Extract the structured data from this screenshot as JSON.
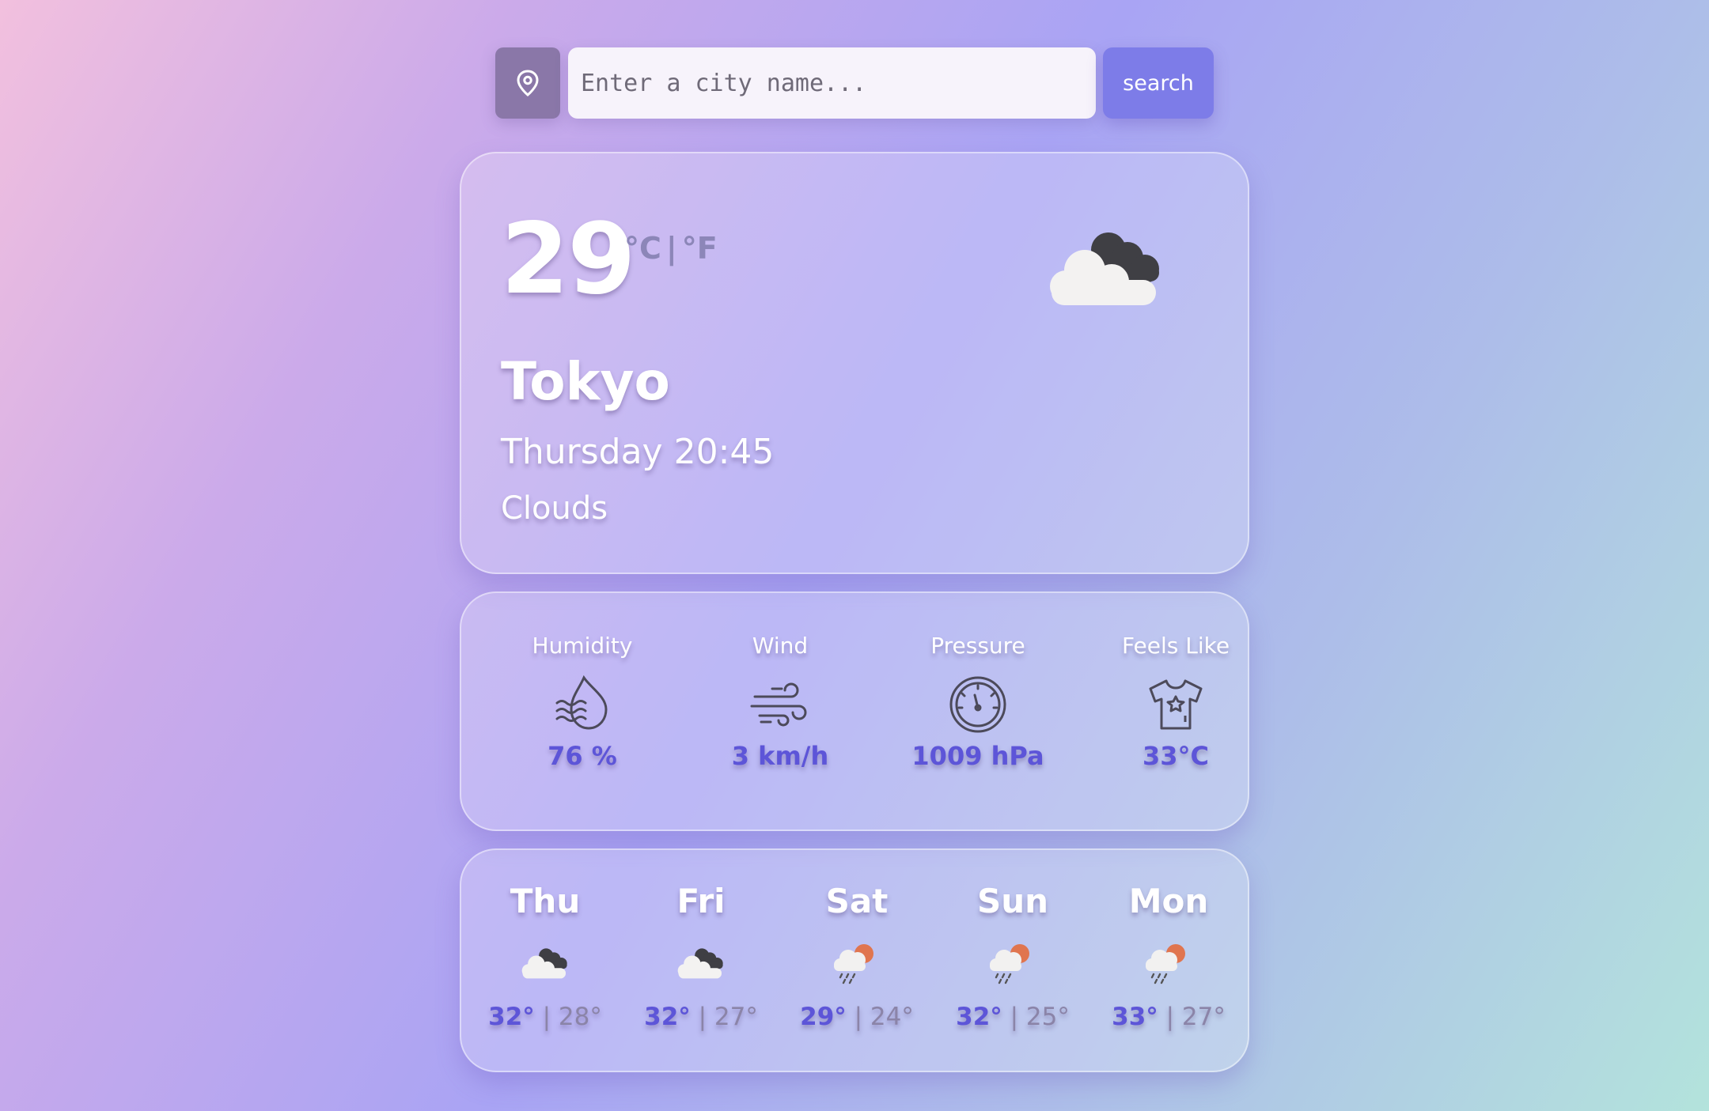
{
  "search": {
    "placeholder": "Enter a city name...",
    "button_label": "search",
    "location_icon": "map-pin-icon"
  },
  "current": {
    "temperature": "29",
    "unit_c": "°C",
    "unit_separator": "|",
    "unit_f": "°F",
    "city": "Tokyo",
    "datetime": "Thursday 20:45",
    "description": "Clouds",
    "icon": "clouds-icon"
  },
  "details": [
    {
      "label": "Humidity",
      "icon": "humidity-icon",
      "value": "76 %"
    },
    {
      "label": "Wind",
      "icon": "wind-icon",
      "value": "3 km/h"
    },
    {
      "label": "Pressure",
      "icon": "pressure-gauge-icon",
      "value": "1009 hPa"
    },
    {
      "label": "Feels Like",
      "icon": "tshirt-icon",
      "value": "33°C"
    }
  ],
  "forecast": [
    {
      "day": "Thu",
      "icon": "clouds-icon",
      "high": "32°",
      "sep": " | ",
      "low": "28°"
    },
    {
      "day": "Fri",
      "icon": "clouds-icon",
      "high": "32°",
      "sep": " | ",
      "low": "27°"
    },
    {
      "day": "Sat",
      "icon": "sun-cloud-rain-icon",
      "high": "29°",
      "sep": " | ",
      "low": "24°"
    },
    {
      "day": "Sun",
      "icon": "sun-cloud-rain-icon",
      "high": "32°",
      "sep": " | ",
      "low": "25°"
    },
    {
      "day": "Mon",
      "icon": "sun-cloud-rain-icon",
      "high": "33°",
      "sep": " | ",
      "low": "27°"
    }
  ],
  "colors": {
    "accent": "#5d55d8",
    "search_button": "#7d7ce8",
    "location_button": "#8a77a8"
  }
}
